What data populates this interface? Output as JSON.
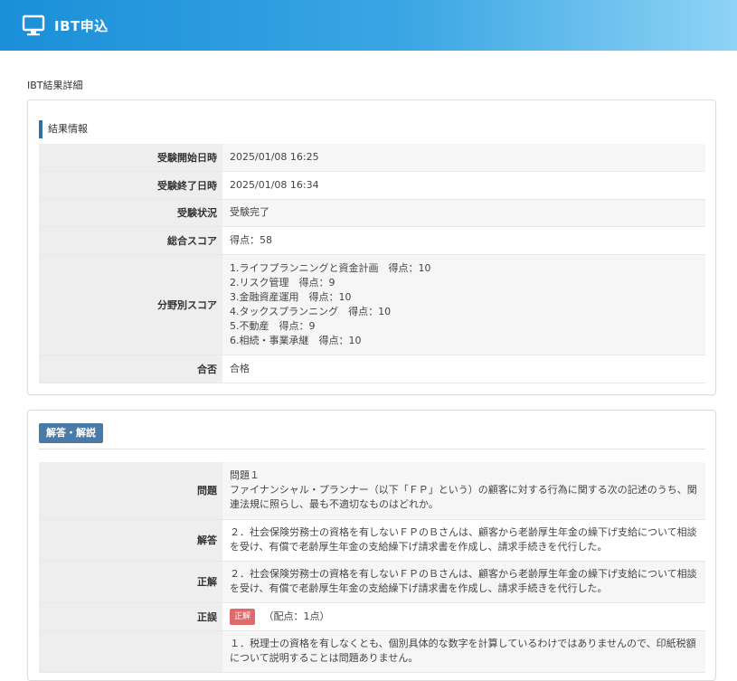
{
  "header": {
    "title": "IBT申込",
    "icon": "monitor-icon"
  },
  "breadcrumb": "IBT結果詳細",
  "result": {
    "section_title": "結果情報",
    "rows": [
      {
        "label": "受験開始日時",
        "value": "2025/01/08 16:25"
      },
      {
        "label": "受験終了日時",
        "value": "2025/01/08 16:34"
      },
      {
        "label": "受験状況",
        "value": "受験完了"
      },
      {
        "label": "総合スコア",
        "value": "得点：58"
      },
      {
        "label": "分野別スコア",
        "lines": [
          "1.ライフプランニングと資金計画　得点：10",
          "2.リスク管理　得点：9",
          "3.金融資産運用　得点：10",
          "4.タックスプランニング　得点：10",
          "5.不動産　得点：9",
          "6.相続・事業承継　得点：10"
        ]
      },
      {
        "label": "合否",
        "value": "合格"
      }
    ]
  },
  "answers": {
    "button_label": "解答・解説",
    "rows": [
      {
        "label": "問題",
        "lines": [
          "問題１",
          "ファイナンシャル・プランナー（以下「ＦＰ」という）の顧客に対する行為に関する次の記述のうち、関連法規に照らし、最も不適切なものはどれか。"
        ]
      },
      {
        "label": "解答",
        "value": "２．社会保険労務士の資格を有しないＦＰのＢさんは、顧客から老齢厚生年金の繰下げ支給について相談を受け、有償で老齢厚生年金の支給繰下げ請求書を作成し、請求手続きを代行した。"
      },
      {
        "label": "正解",
        "value": "２．社会保険労務士の資格を有しないＦＰのＢさんは、顧客から老齢厚生年金の繰下げ支給について相談を受け、有償で老齢厚生年金の支給繰下げ請求書を作成し、請求手続きを代行した。"
      },
      {
        "label": "正誤",
        "badge": "正解",
        "value": "（配点：1点）"
      },
      {
        "label": "",
        "value": "１．税理士の資格を有しなくとも、個別具体的な数字を計算しているわけではありませんので、印紙税額について説明することは問題ありません。"
      }
    ]
  },
  "colors": {
    "header_start": "#1a8fd8",
    "header_end": "#8fd3f5",
    "accent": "#2f6fa8",
    "badge": "#e06a6a"
  }
}
